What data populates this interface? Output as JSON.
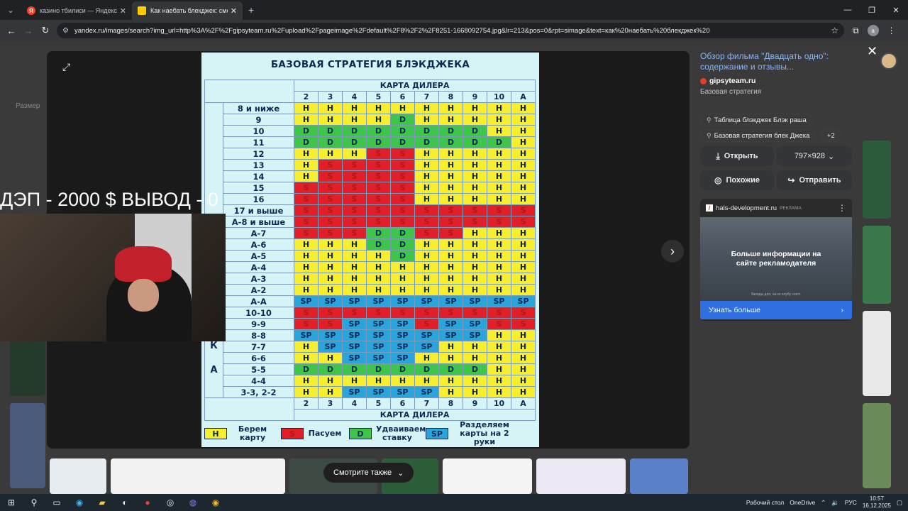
{
  "browser": {
    "tabs": [
      {
        "label": "казино тбилиси — Яндекс: на",
        "favicon": "yandex-icon"
      },
      {
        "label": "Как наебать блекджек: смотр",
        "favicon": "yandex-images-icon"
      }
    ],
    "url": "yandex.ru/images/search?img_url=http%3A%2F%2Fgipsyteam.ru%2Fupload%2Fpageimage%2Fdefault%2F8%2F2%2F8251-1668092754.jpg&lr=213&pos=0&rpt=simage&text=как%20наебать%20блекджек%20",
    "profile_initial": "a"
  },
  "background_page": {
    "filter_label": "Размер"
  },
  "overlay": {
    "stream_text": "ДЭП - 2000 $ ВЫВОД - 0"
  },
  "chart_image": {
    "title": "БАЗОВАЯ СТРАТЕГИЯ БЛЭКДЖЕКА",
    "dealer_header": "КАРТА ДИЛЕРА",
    "dealer_cards": [
      "2",
      "3",
      "4",
      "5",
      "6",
      "7",
      "8",
      "9",
      "10",
      "A"
    ],
    "side_letters": [
      "И",
      "Г",
      "Р",
      "О",
      "К",
      "А"
    ],
    "rows": [
      {
        "label": "8 и ниже",
        "cells": [
          "H",
          "H",
          "H",
          "H",
          "H",
          "H",
          "H",
          "H",
          "H",
          "H"
        ]
      },
      {
        "label": "9",
        "cells": [
          "H",
          "H",
          "H",
          "H",
          "D",
          "H",
          "H",
          "H",
          "H",
          "H"
        ]
      },
      {
        "label": "10",
        "cells": [
          "D",
          "D",
          "D",
          "D",
          "D",
          "D",
          "D",
          "D",
          "H",
          "H"
        ]
      },
      {
        "label": "11",
        "cells": [
          "D",
          "D",
          "D",
          "D",
          "D",
          "D",
          "D",
          "D",
          "D",
          "H"
        ]
      },
      {
        "label": "12",
        "cells": [
          "H",
          "H",
          "H",
          "S",
          "S",
          "H",
          "H",
          "H",
          "H",
          "H"
        ]
      },
      {
        "label": "13",
        "cells": [
          "H",
          "S",
          "S",
          "S",
          "S",
          "H",
          "H",
          "H",
          "H",
          "H"
        ]
      },
      {
        "label": "14",
        "cells": [
          "H",
          "S",
          "S",
          "S",
          "S",
          "H",
          "H",
          "H",
          "H",
          "H"
        ]
      },
      {
        "label": "15",
        "cells": [
          "S",
          "S",
          "S",
          "S",
          "S",
          "H",
          "H",
          "H",
          "H",
          "H"
        ]
      },
      {
        "label": "16",
        "cells": [
          "S",
          "S",
          "S",
          "S",
          "S",
          "H",
          "H",
          "H",
          "H",
          "H"
        ]
      },
      {
        "label": "17 и выше",
        "cells": [
          "S",
          "S",
          "S",
          "S",
          "S",
          "S",
          "S",
          "S",
          "S",
          "S"
        ]
      },
      {
        "label": "А-8 и выше",
        "cells": [
          "S",
          "S",
          "S",
          "S",
          "S",
          "S",
          "S",
          "S",
          "S",
          "S"
        ]
      },
      {
        "label": "А-7",
        "cells": [
          "S",
          "S",
          "S",
          "D",
          "D",
          "S",
          "S",
          "H",
          "H",
          "H"
        ]
      },
      {
        "label": "А-6",
        "cells": [
          "H",
          "H",
          "H",
          "D",
          "D",
          "H",
          "H",
          "H",
          "H",
          "H"
        ]
      },
      {
        "label": "А-5",
        "cells": [
          "H",
          "H",
          "H",
          "H",
          "D",
          "H",
          "H",
          "H",
          "H",
          "H"
        ]
      },
      {
        "label": "А-4",
        "cells": [
          "H",
          "H",
          "H",
          "H",
          "H",
          "H",
          "H",
          "H",
          "H",
          "H"
        ]
      },
      {
        "label": "А-3",
        "cells": [
          "H",
          "H",
          "H",
          "H",
          "H",
          "H",
          "H",
          "H",
          "H",
          "H"
        ]
      },
      {
        "label": "А-2",
        "cells": [
          "H",
          "H",
          "H",
          "H",
          "H",
          "H",
          "H",
          "H",
          "H",
          "H"
        ]
      },
      {
        "label": "А-А",
        "cells": [
          "SP",
          "SP",
          "SP",
          "SP",
          "SP",
          "SP",
          "SP",
          "SP",
          "SP",
          "SP"
        ]
      },
      {
        "label": "10-10",
        "cells": [
          "S",
          "S",
          "S",
          "S",
          "S",
          "S",
          "S",
          "S",
          "S",
          "S"
        ]
      },
      {
        "label": "9-9",
        "cells": [
          "S",
          "S",
          "SP",
          "SP",
          "SP",
          "S",
          "SP",
          "SP",
          "S",
          "S"
        ]
      },
      {
        "label": "8-8",
        "cells": [
          "SP",
          "SP",
          "SP",
          "SP",
          "SP",
          "SP",
          "SP",
          "SP",
          "H",
          "H"
        ]
      },
      {
        "label": "7-7",
        "cells": [
          "H",
          "SP",
          "SP",
          "SP",
          "SP",
          "SP",
          "H",
          "H",
          "H",
          "H"
        ]
      },
      {
        "label": "6-6",
        "cells": [
          "H",
          "H",
          "SP",
          "SP",
          "SP",
          "H",
          "H",
          "H",
          "H",
          "H"
        ]
      },
      {
        "label": "5-5",
        "cells": [
          "D",
          "D",
          "D",
          "D",
          "D",
          "D",
          "D",
          "D",
          "H",
          "H"
        ]
      },
      {
        "label": "4-4",
        "cells": [
          "H",
          "H",
          "H",
          "H",
          "H",
          "H",
          "H",
          "H",
          "H",
          "H"
        ]
      },
      {
        "label": "3-3, 2-2",
        "cells": [
          "H",
          "H",
          "SP",
          "SP",
          "SP",
          "SP",
          "H",
          "H",
          "H",
          "H"
        ]
      }
    ],
    "legend": [
      {
        "code": "H",
        "text": "Берем карту"
      },
      {
        "code": "S",
        "text": "Пасуем"
      },
      {
        "code": "D",
        "text": "Удваиваем ставку"
      },
      {
        "code": "SP",
        "text": "Разделяем карты на 2 руки"
      }
    ],
    "colors": {
      "H": "#f7ef2e",
      "S": "#e01f28",
      "D": "#3fc64a",
      "SP": "#28a5dd"
    }
  },
  "side_panel": {
    "title": "Обзор фильма \"Двадцать одно\": содержание и отзывы...",
    "source": "gipsyteam.ru",
    "subtitle": "Базовая стратегия",
    "chips": [
      "Таблица блэкджек Блэк раша",
      "Базовая стратегия блек Джека"
    ],
    "chips_more": "+2",
    "open_label": "Открыть",
    "size_label": "797×928",
    "similar_label": "Похожие",
    "share_label": "Отправить",
    "ad": {
      "domain": "hals-development.ru",
      "tag": "РЕКЛАМА",
      "image_text": "Больше информации на сайте рекламодателя",
      "fine_print": "Заходы для, на ко клубу сектт.",
      "cta": "Узнать больше"
    }
  },
  "see_also_label": "Смотрите также",
  "taskbar": {
    "desktop_label": "Рабочий стол",
    "onedrive_label": "OneDrive",
    "lang": "РУС",
    "time": "10:57",
    "date": "16.12.2025"
  }
}
